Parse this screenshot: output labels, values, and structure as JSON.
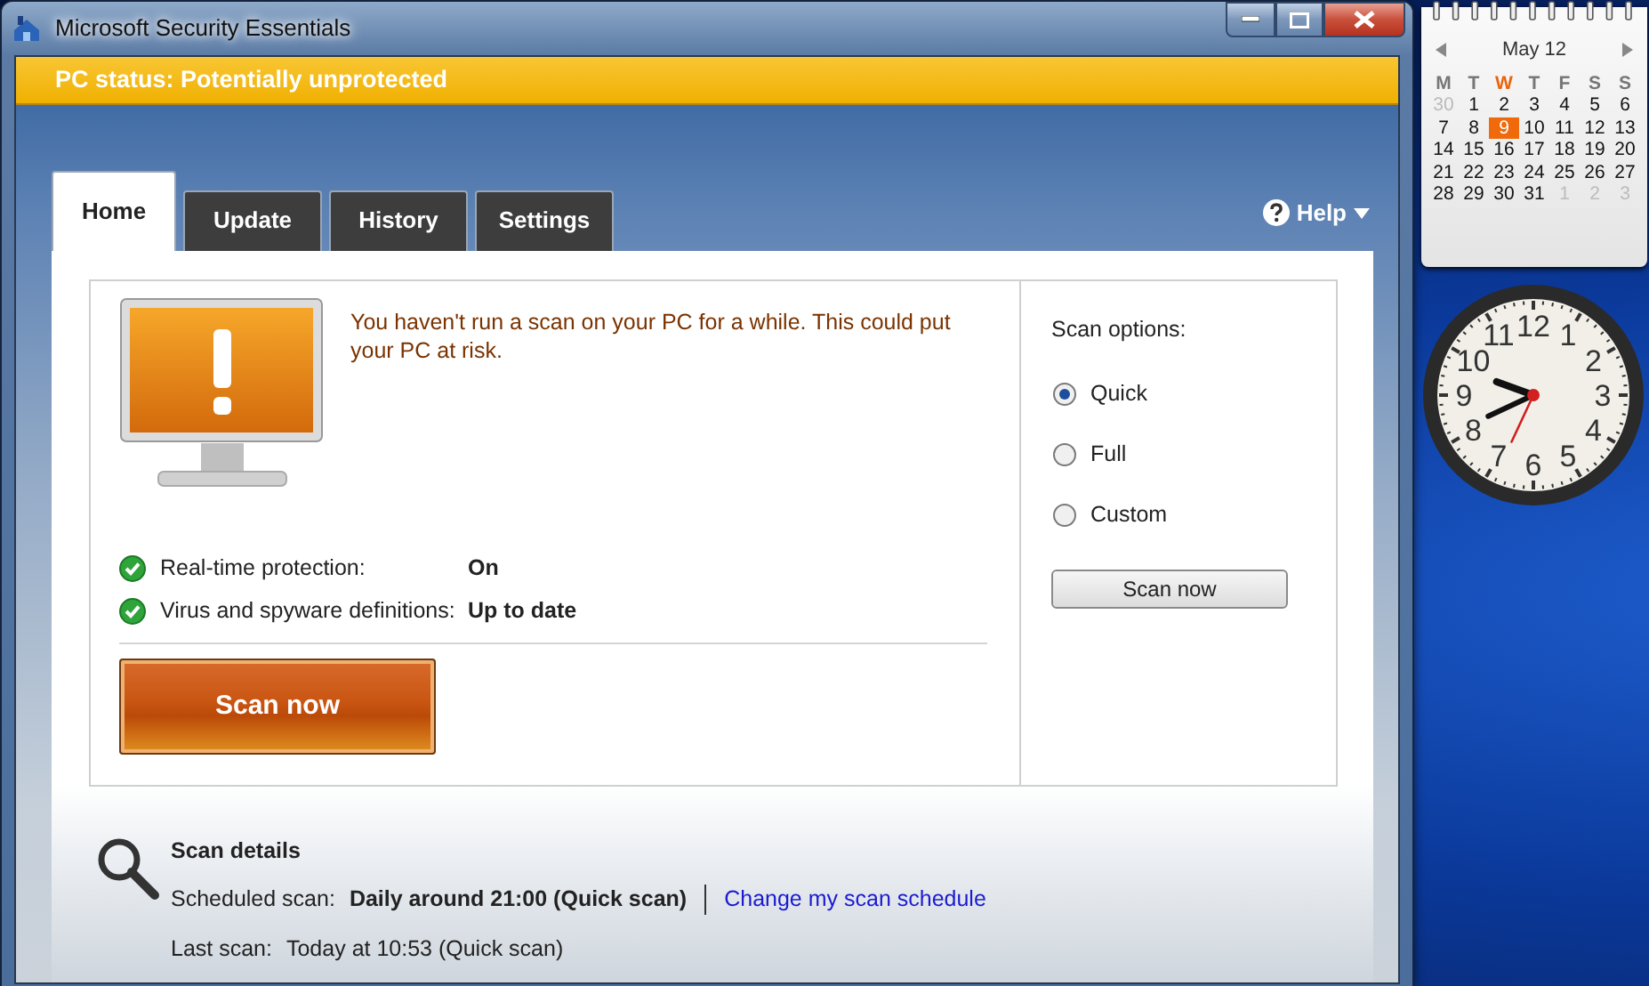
{
  "window": {
    "title": "Microsoft Security Essentials"
  },
  "status_banner": {
    "text": "PC status: Potentially unprotected"
  },
  "tabs": [
    {
      "label": "Home",
      "selected": true
    },
    {
      "label": "Update",
      "selected": false
    },
    {
      "label": "History",
      "selected": false
    },
    {
      "label": "Settings",
      "selected": false
    }
  ],
  "help": {
    "label": "Help"
  },
  "alert": {
    "message": "You haven't run a scan on your PC for a while. This could put your PC at risk."
  },
  "protection": [
    {
      "label": "Real-time protection:",
      "value": "On",
      "ok": true
    },
    {
      "label": "Virus and spyware definitions:",
      "value": "Up to date",
      "ok": true
    }
  ],
  "scan_button": {
    "label": "Scan now"
  },
  "scan_options": {
    "title": "Scan options:",
    "options": [
      {
        "label": "Quick",
        "selected": true
      },
      {
        "label": "Full",
        "selected": false
      },
      {
        "label": "Custom",
        "selected": false
      }
    ],
    "button": "Scan now"
  },
  "scan_details": {
    "title": "Scan details",
    "scheduled_label": "Scheduled scan:",
    "scheduled_value": "Daily around 21:00 (Quick scan)",
    "link": "Change my scan schedule",
    "last_label": "Last scan:",
    "last_value": "Today at 10:53 (Quick scan)"
  },
  "calendar": {
    "month": "May 12",
    "weekdays": [
      {
        "text": "M",
        "today": false
      },
      {
        "text": "T",
        "today": false
      },
      {
        "text": "W",
        "today": true
      },
      {
        "text": "T",
        "today": false
      },
      {
        "text": "F",
        "today": false
      },
      {
        "text": "S",
        "today": false
      },
      {
        "text": "S",
        "today": false
      }
    ],
    "weeks": [
      [
        {
          "text": "30",
          "other_month": true,
          "selected": false
        },
        {
          "text": "1",
          "other_month": false,
          "selected": false
        },
        {
          "text": "2",
          "other_month": false,
          "selected": false
        },
        {
          "text": "3",
          "other_month": false,
          "selected": false
        },
        {
          "text": "4",
          "other_month": false,
          "selected": false
        },
        {
          "text": "5",
          "other_month": false,
          "selected": false
        },
        {
          "text": "6",
          "other_month": false,
          "selected": false
        }
      ],
      [
        {
          "text": "7",
          "other_month": false,
          "selected": false
        },
        {
          "text": "8",
          "other_month": false,
          "selected": false
        },
        {
          "text": "9",
          "other_month": false,
          "selected": true
        },
        {
          "text": "10",
          "other_month": false,
          "selected": false
        },
        {
          "text": "11",
          "other_month": false,
          "selected": false
        },
        {
          "text": "12",
          "other_month": false,
          "selected": false
        },
        {
          "text": "13",
          "other_month": false,
          "selected": false
        }
      ],
      [
        {
          "text": "14",
          "other_month": false,
          "selected": false
        },
        {
          "text": "15",
          "other_month": false,
          "selected": false
        },
        {
          "text": "16",
          "other_month": false,
          "selected": false
        },
        {
          "text": "17",
          "other_month": false,
          "selected": false
        },
        {
          "text": "18",
          "other_month": false,
          "selected": false
        },
        {
          "text": "19",
          "other_month": false,
          "selected": false
        },
        {
          "text": "20",
          "other_month": false,
          "selected": false
        }
      ],
      [
        {
          "text": "21",
          "other_month": false,
          "selected": false
        },
        {
          "text": "22",
          "other_month": false,
          "selected": false
        },
        {
          "text": "23",
          "other_month": false,
          "selected": false
        },
        {
          "text": "24",
          "other_month": false,
          "selected": false
        },
        {
          "text": "25",
          "other_month": false,
          "selected": false
        },
        {
          "text": "26",
          "other_month": false,
          "selected": false
        },
        {
          "text": "27",
          "other_month": false,
          "selected": false
        }
      ],
      [
        {
          "text": "28",
          "other_month": false,
          "selected": false
        },
        {
          "text": "29",
          "other_month": false,
          "selected": false
        },
        {
          "text": "30",
          "other_month": false,
          "selected": false
        },
        {
          "text": "31",
          "other_month": false,
          "selected": false
        },
        {
          "text": "1",
          "other_month": true,
          "selected": false
        },
        {
          "text": "2",
          "other_month": true,
          "selected": false
        },
        {
          "text": "3",
          "other_month": true,
          "selected": false
        }
      ]
    ]
  },
  "clock": {
    "numerals": [
      "12",
      "11",
      "1",
      "10",
      "2",
      "9",
      "3",
      "8",
      "4",
      "7",
      "5",
      "6"
    ]
  }
}
